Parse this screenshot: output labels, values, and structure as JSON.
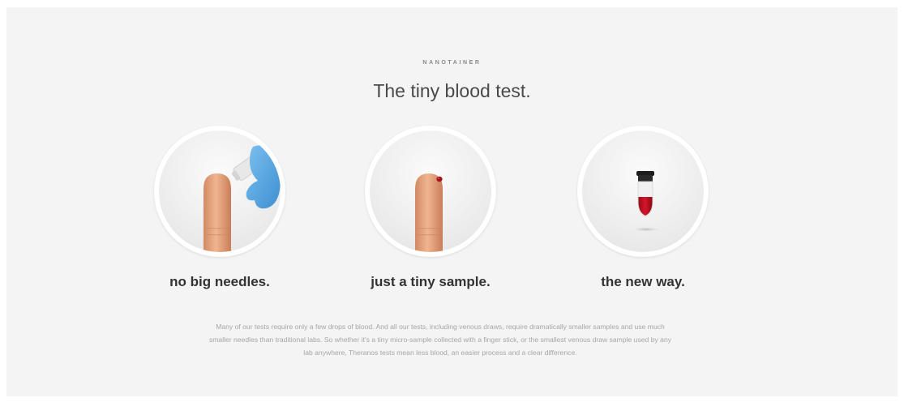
{
  "header": {
    "eyebrow": "NANOTAINER",
    "title": "The tiny blood test."
  },
  "features": [
    {
      "icon": "finger-with-needle-icon",
      "caption": "no big needles."
    },
    {
      "icon": "finger-with-blood-drop-icon",
      "caption": "just a tiny sample."
    },
    {
      "icon": "blood-vial-icon",
      "caption": "the new way."
    }
  ],
  "body": {
    "text": "Many of our tests require only a few drops of blood. And all our tests, including venous draws, require dramatically smaller samples and use much smaller needles than traditional labs. So whether it's a tiny micro-sample collected with a finger stick, or the smallest venous draw sample used by any lab anywhere, Theranos tests mean less blood, an easier process and a clear difference."
  },
  "colors": {
    "background": "#f4f4f4",
    "title": "#4a4a4a",
    "caption": "#333333",
    "body": "#a6a6a6",
    "blood": "#c4121f",
    "glove": "#5aa9e6"
  }
}
